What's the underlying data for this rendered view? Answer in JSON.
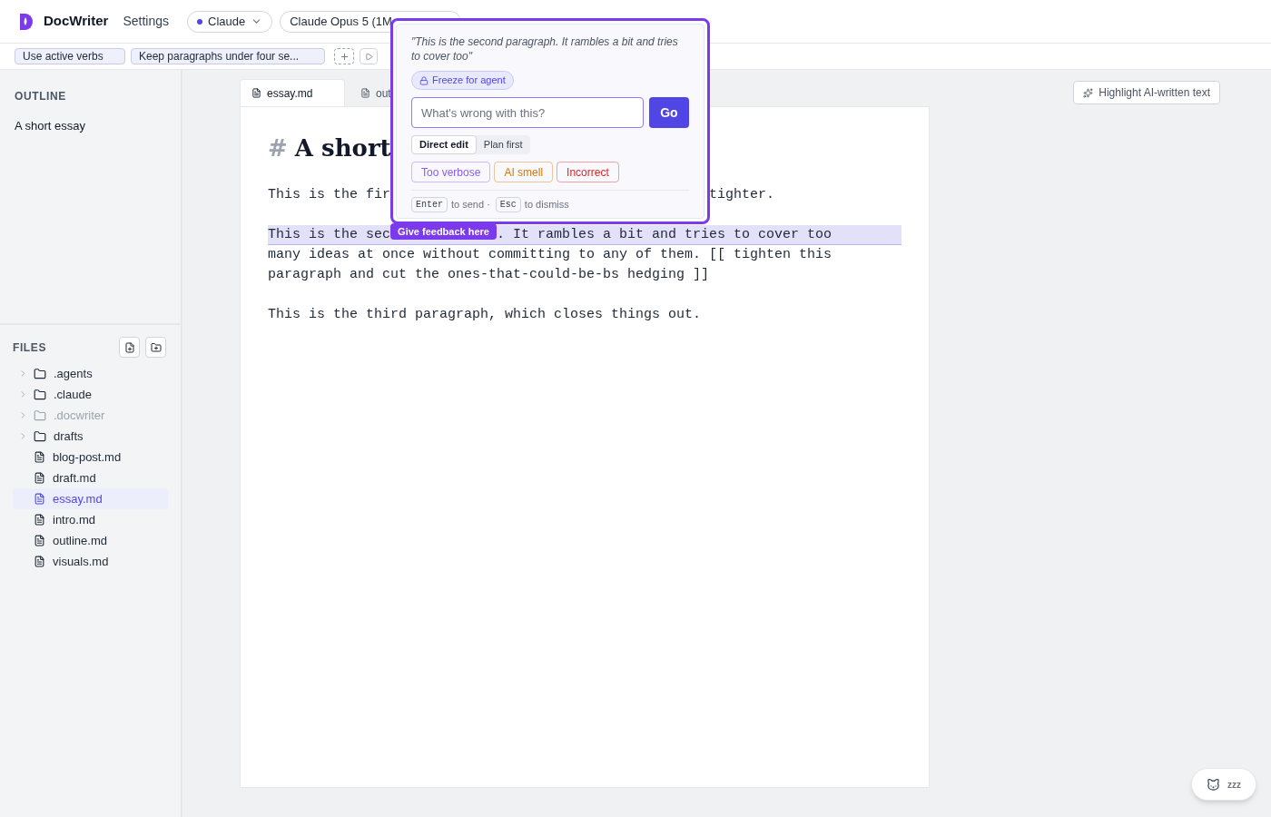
{
  "app": {
    "name": "DocWriter",
    "settings": "Settings"
  },
  "provider": {
    "label": "Claude",
    "color": "#4f46e5"
  },
  "model": {
    "label": "Claude Opus 5 (1M"
  },
  "rules": [
    {
      "label": "Use active verbs"
    },
    {
      "label": "Keep paragraphs under four se..."
    }
  ],
  "outline": {
    "title": "OUTLINE",
    "items": [
      {
        "label": "A short essay"
      }
    ]
  },
  "files": {
    "title": "FILES",
    "items": [
      {
        "kind": "folder",
        "name": ".agents",
        "dimmed": false,
        "selected": false
      },
      {
        "kind": "folder",
        "name": ".claude",
        "dimmed": false,
        "selected": false
      },
      {
        "kind": "folder",
        "name": ".docwriter",
        "dimmed": true,
        "selected": false
      },
      {
        "kind": "folder",
        "name": "drafts",
        "dimmed": false,
        "selected": false
      },
      {
        "kind": "file",
        "name": "blog-post.md",
        "dimmed": false,
        "selected": false
      },
      {
        "kind": "file",
        "name": "draft.md",
        "dimmed": false,
        "selected": false
      },
      {
        "kind": "file",
        "name": "essay.md",
        "dimmed": false,
        "selected": true
      },
      {
        "kind": "file",
        "name": "intro.md",
        "dimmed": false,
        "selected": false
      },
      {
        "kind": "file",
        "name": "outline.md",
        "dimmed": false,
        "selected": false
      },
      {
        "kind": "file",
        "name": "visuals.md",
        "dimmed": false,
        "selected": false
      }
    ]
  },
  "tabs": [
    {
      "label": "essay.md",
      "selected": true
    },
    {
      "label": "out",
      "selected": false
    }
  ],
  "highlight_button": "Highlight AI-written text",
  "document": {
    "heading_mark": "#",
    "heading": "A short",
    "paragraphs": [
      {
        "lines": [
          {
            "kind": "split",
            "before": "This is the fir",
            "after": "tighter.",
            "highlighted": false
          }
        ]
      },
      {
        "lines": [
          {
            "kind": "tagged",
            "before": "This is the sec",
            "tag": "Give feedback here",
            "after": ". It rambles a bit and tries to cover too",
            "highlighted": true
          },
          {
            "kind": "plain",
            "text": "many ideas at once without committing to any of them. [[ tighten this",
            "highlighted": false
          },
          {
            "kind": "plain",
            "text": "paragraph and cut the ones-that-could-be-bs hedging ]]",
            "highlighted": false
          }
        ]
      },
      {
        "lines": [
          {
            "kind": "plain",
            "text": "This is the third paragraph, which closes things out.",
            "highlighted": false
          }
        ]
      }
    ]
  },
  "popover": {
    "quote": "\"This is the second paragraph. It rambles a bit and tries to cover too\"",
    "freeze": "Freeze for agent",
    "placeholder": "What's wrong with this?",
    "go": "Go",
    "modes": [
      {
        "label": "Direct edit",
        "selected": true
      },
      {
        "label": "Plan first",
        "selected": false
      }
    ],
    "tags": [
      {
        "label": "Too verbose",
        "color": "#8b5cf6"
      },
      {
        "label": "AI smell",
        "color": "#d97706"
      },
      {
        "label": "Incorrect",
        "color": "#dc2626"
      }
    ],
    "hints": [
      {
        "key": "Enter",
        "text": "to send ·"
      },
      {
        "key": "Esc",
        "text": "to dismiss"
      }
    ]
  },
  "sleep_button": {
    "label": "zzz"
  }
}
